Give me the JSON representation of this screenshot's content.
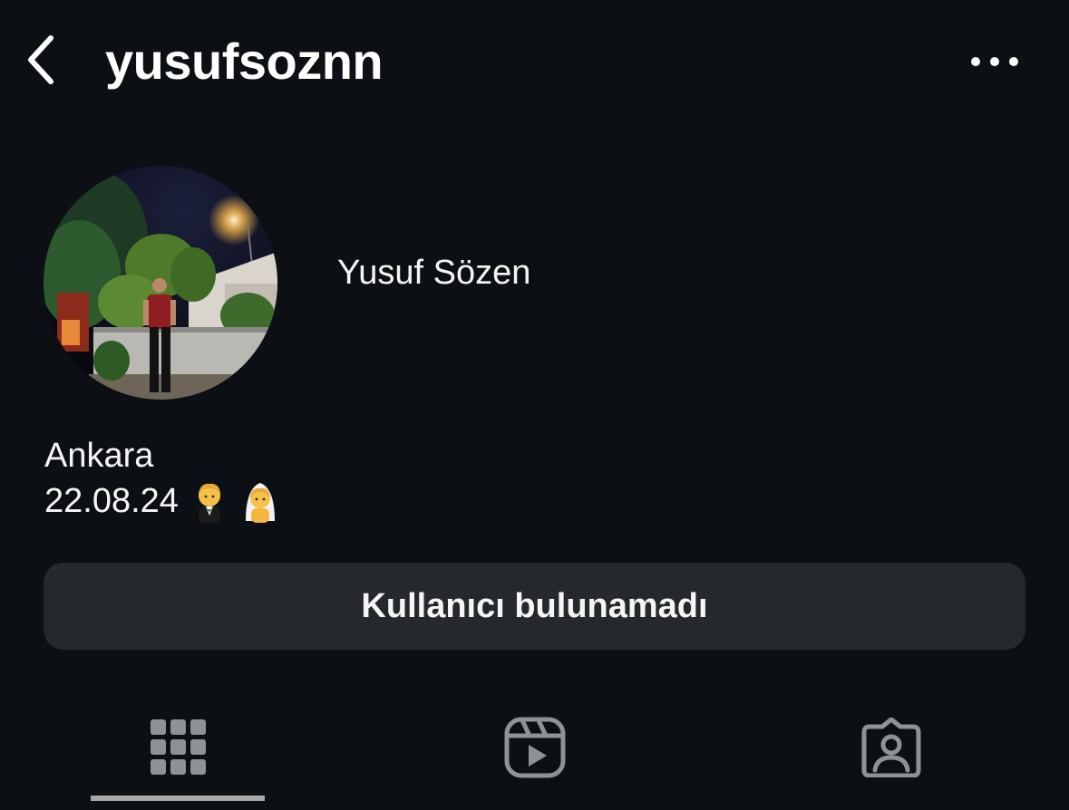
{
  "header": {
    "username": "yusufsoznn",
    "back_icon": "chevron-left-icon",
    "more_icon": "more-horizontal-icon"
  },
  "profile": {
    "display_name": "Yusuf Sözen",
    "bio_location": "Ankara",
    "bio_date": "22.08.24"
  },
  "status": {
    "label": "Kullanıcı bulunamadı"
  },
  "tabs": [
    {
      "icon": "grid-icon",
      "active": true
    },
    {
      "icon": "reels-icon",
      "active": false
    },
    {
      "icon": "tagged-icon",
      "active": false
    }
  ],
  "colors": {
    "background": "#0c1014",
    "status_box": "#25292e",
    "text": "#f5f5f5",
    "inactive_icon": "#8e9296"
  }
}
